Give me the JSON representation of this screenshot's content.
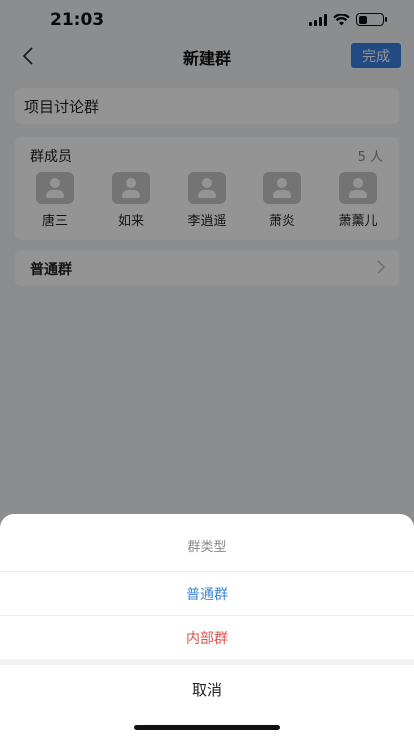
{
  "status_bar": {
    "time": "21:03",
    "battery_level": 0.35
  },
  "nav": {
    "title": "新建群",
    "done_label": "完成",
    "back_icon": "chevron-left-icon"
  },
  "group_name": "项目讨论群",
  "members": {
    "label": "群成员",
    "count": "5 人",
    "items": [
      {
        "name": "唐三"
      },
      {
        "name": "如来"
      },
      {
        "name": "李逍遥"
      },
      {
        "name": "萧炎"
      },
      {
        "name": "萧薰儿"
      }
    ]
  },
  "group_type": {
    "value": "普通群",
    "chevron_icon": "chevron-right-icon"
  },
  "sheet": {
    "title": "群类型",
    "options": [
      {
        "label": "普通群",
        "color": "#3d86d6"
      },
      {
        "label": "内部群",
        "color": "#d9534f"
      }
    ],
    "cancel_label": "取消"
  },
  "colors": {
    "accent": "#3a7fe0",
    "overlay": "rgba(0,0,0,0.42)"
  }
}
